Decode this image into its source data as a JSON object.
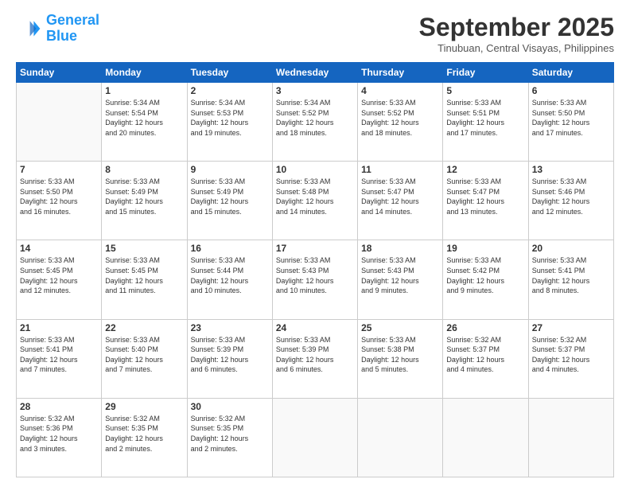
{
  "header": {
    "logo_line1": "General",
    "logo_line2": "Blue",
    "month": "September 2025",
    "location": "Tinubuan, Central Visayas, Philippines"
  },
  "weekdays": [
    "Sunday",
    "Monday",
    "Tuesday",
    "Wednesday",
    "Thursday",
    "Friday",
    "Saturday"
  ],
  "weeks": [
    [
      {
        "day": "",
        "info": ""
      },
      {
        "day": "1",
        "info": "Sunrise: 5:34 AM\nSunset: 5:54 PM\nDaylight: 12 hours\nand 20 minutes."
      },
      {
        "day": "2",
        "info": "Sunrise: 5:34 AM\nSunset: 5:53 PM\nDaylight: 12 hours\nand 19 minutes."
      },
      {
        "day": "3",
        "info": "Sunrise: 5:34 AM\nSunset: 5:52 PM\nDaylight: 12 hours\nand 18 minutes."
      },
      {
        "day": "4",
        "info": "Sunrise: 5:33 AM\nSunset: 5:52 PM\nDaylight: 12 hours\nand 18 minutes."
      },
      {
        "day": "5",
        "info": "Sunrise: 5:33 AM\nSunset: 5:51 PM\nDaylight: 12 hours\nand 17 minutes."
      },
      {
        "day": "6",
        "info": "Sunrise: 5:33 AM\nSunset: 5:50 PM\nDaylight: 12 hours\nand 17 minutes."
      }
    ],
    [
      {
        "day": "7",
        "info": "Sunrise: 5:33 AM\nSunset: 5:50 PM\nDaylight: 12 hours\nand 16 minutes."
      },
      {
        "day": "8",
        "info": "Sunrise: 5:33 AM\nSunset: 5:49 PM\nDaylight: 12 hours\nand 15 minutes."
      },
      {
        "day": "9",
        "info": "Sunrise: 5:33 AM\nSunset: 5:49 PM\nDaylight: 12 hours\nand 15 minutes."
      },
      {
        "day": "10",
        "info": "Sunrise: 5:33 AM\nSunset: 5:48 PM\nDaylight: 12 hours\nand 14 minutes."
      },
      {
        "day": "11",
        "info": "Sunrise: 5:33 AM\nSunset: 5:47 PM\nDaylight: 12 hours\nand 14 minutes."
      },
      {
        "day": "12",
        "info": "Sunrise: 5:33 AM\nSunset: 5:47 PM\nDaylight: 12 hours\nand 13 minutes."
      },
      {
        "day": "13",
        "info": "Sunrise: 5:33 AM\nSunset: 5:46 PM\nDaylight: 12 hours\nand 12 minutes."
      }
    ],
    [
      {
        "day": "14",
        "info": "Sunrise: 5:33 AM\nSunset: 5:45 PM\nDaylight: 12 hours\nand 12 minutes."
      },
      {
        "day": "15",
        "info": "Sunrise: 5:33 AM\nSunset: 5:45 PM\nDaylight: 12 hours\nand 11 minutes."
      },
      {
        "day": "16",
        "info": "Sunrise: 5:33 AM\nSunset: 5:44 PM\nDaylight: 12 hours\nand 10 minutes."
      },
      {
        "day": "17",
        "info": "Sunrise: 5:33 AM\nSunset: 5:43 PM\nDaylight: 12 hours\nand 10 minutes."
      },
      {
        "day": "18",
        "info": "Sunrise: 5:33 AM\nSunset: 5:43 PM\nDaylight: 12 hours\nand 9 minutes."
      },
      {
        "day": "19",
        "info": "Sunrise: 5:33 AM\nSunset: 5:42 PM\nDaylight: 12 hours\nand 9 minutes."
      },
      {
        "day": "20",
        "info": "Sunrise: 5:33 AM\nSunset: 5:41 PM\nDaylight: 12 hours\nand 8 minutes."
      }
    ],
    [
      {
        "day": "21",
        "info": "Sunrise: 5:33 AM\nSunset: 5:41 PM\nDaylight: 12 hours\nand 7 minutes."
      },
      {
        "day": "22",
        "info": "Sunrise: 5:33 AM\nSunset: 5:40 PM\nDaylight: 12 hours\nand 7 minutes."
      },
      {
        "day": "23",
        "info": "Sunrise: 5:33 AM\nSunset: 5:39 PM\nDaylight: 12 hours\nand 6 minutes."
      },
      {
        "day": "24",
        "info": "Sunrise: 5:33 AM\nSunset: 5:39 PM\nDaylight: 12 hours\nand 6 minutes."
      },
      {
        "day": "25",
        "info": "Sunrise: 5:33 AM\nSunset: 5:38 PM\nDaylight: 12 hours\nand 5 minutes."
      },
      {
        "day": "26",
        "info": "Sunrise: 5:32 AM\nSunset: 5:37 PM\nDaylight: 12 hours\nand 4 minutes."
      },
      {
        "day": "27",
        "info": "Sunrise: 5:32 AM\nSunset: 5:37 PM\nDaylight: 12 hours\nand 4 minutes."
      }
    ],
    [
      {
        "day": "28",
        "info": "Sunrise: 5:32 AM\nSunset: 5:36 PM\nDaylight: 12 hours\nand 3 minutes."
      },
      {
        "day": "29",
        "info": "Sunrise: 5:32 AM\nSunset: 5:35 PM\nDaylight: 12 hours\nand 2 minutes."
      },
      {
        "day": "30",
        "info": "Sunrise: 5:32 AM\nSunset: 5:35 PM\nDaylight: 12 hours\nand 2 minutes."
      },
      {
        "day": "",
        "info": ""
      },
      {
        "day": "",
        "info": ""
      },
      {
        "day": "",
        "info": ""
      },
      {
        "day": "",
        "info": ""
      }
    ]
  ]
}
